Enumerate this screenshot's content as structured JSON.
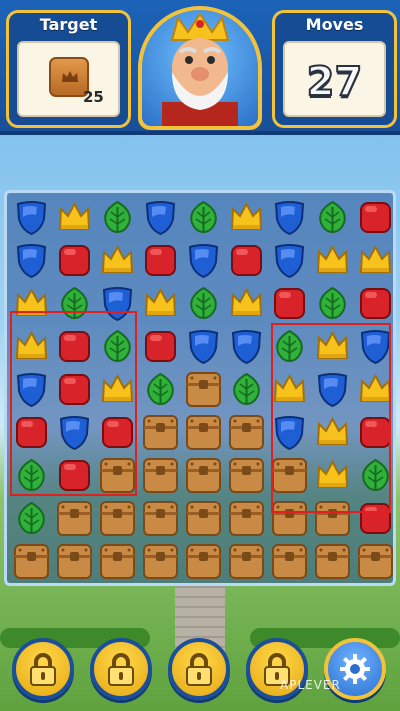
{
  "hud": {
    "target_label": "Target",
    "target_count": "25",
    "moves_label": "Moves",
    "moves_value": "27",
    "portrait": "king-portrait"
  },
  "board": {
    "rows": [
      [
        "shield",
        "crown",
        "leaf",
        "shield",
        "leaf",
        "crown",
        "shield",
        "leaf",
        "box"
      ],
      [
        "shield",
        "box",
        "crown",
        "box",
        "shield",
        "box",
        "shield",
        "crown",
        "crown"
      ],
      [
        "crown",
        "leaf",
        "shield",
        "crown",
        "leaf",
        "crown",
        "box",
        "leaf",
        "box"
      ],
      [
        "crown",
        "box",
        "leaf",
        "box",
        "shield",
        "shield",
        "leaf",
        "crown",
        "shield"
      ],
      [
        "shield",
        "box",
        "crown",
        "leaf",
        "chest",
        "leaf",
        "crown",
        "shield",
        "crown"
      ],
      [
        "box",
        "shield",
        "box",
        "chest",
        "chest",
        "chest",
        "shield",
        "crown",
        "box"
      ],
      [
        "leaf",
        "box",
        "chest",
        "chest",
        "chest",
        "chest",
        "chest",
        "crown",
        "leaf"
      ],
      [
        "leaf",
        "chest",
        "chest",
        "chest",
        "chest",
        "chest",
        "chest",
        "chest",
        "box"
      ],
      [
        "chest",
        "chest",
        "chest",
        "chest",
        "chest",
        "chest",
        "chest",
        "chest",
        "chest"
      ]
    ]
  },
  "bottom_bar": {
    "buttons": [
      "lock-icon",
      "lock-icon",
      "lock-icon",
      "lock-icon",
      "gear-icon"
    ]
  },
  "watermark": "APLEVER",
  "colors": {
    "shield": "#1f5fd6",
    "crown": "#f6c21b",
    "leaf": "#2fb13a",
    "box": "#d9232a",
    "chest": "#c98a45",
    "hud_blue": "#1a4f98",
    "gold": "#f2c23a",
    "highlight": "#e02020"
  }
}
